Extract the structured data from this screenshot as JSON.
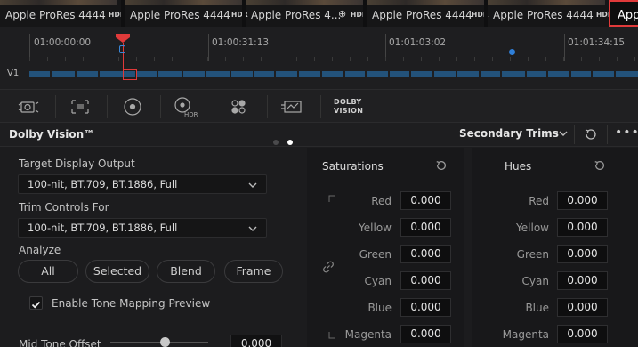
{
  "clips": [
    {
      "name": "Apple ProRes 4444",
      "badge": "HDR"
    },
    {
      "name": "Apple ProRes 4444",
      "badge": "HDR"
    },
    {
      "name": "Apple ProRes 4...",
      "badge": "HDR"
    },
    {
      "name": "Apple ProRes 4444",
      "badge": "HDR"
    },
    {
      "name": "Apple ProRes 4444",
      "badge": "HDR"
    },
    {
      "name": "Apple",
      "badge": ""
    }
  ],
  "timeline": {
    "timecodes": [
      "01:00:00:00",
      "01:00:31:13",
      "01:01:03:02",
      "01:01:34:15"
    ],
    "track_label": "V1"
  },
  "toolbar": {
    "dolby_line1": "DOLBY",
    "dolby_line2": "VISION",
    "icons": [
      "camera-raw-icon",
      "color-match-icon",
      "primaries-icon",
      "hdr-icon",
      "rgb-mixer-icon",
      "motion-effects-icon"
    ]
  },
  "panel": {
    "title": "Dolby Vision™",
    "trims_select": "Secondary Trims"
  },
  "left": {
    "target_label": "Target Display Output",
    "target_value": "100-nit, BT.709, BT.1886, Full",
    "trim_label": "Trim Controls For",
    "trim_value": "100-nit, BT.709, BT.1886, Full",
    "analyze_label": "Analyze",
    "analyze_buttons": [
      "All",
      "Selected",
      "Blend",
      "Frame"
    ],
    "tone_mapping_label": "Enable Tone Mapping Preview",
    "tone_mapping_checked": true,
    "mid_tone_label": "Mid Tone Offset",
    "mid_tone_value": "0.000"
  },
  "saturations": {
    "title": "Saturations",
    "rows": [
      {
        "label": "Red",
        "value": "0.000"
      },
      {
        "label": "Yellow",
        "value": "0.000"
      },
      {
        "label": "Green",
        "value": "0.000"
      },
      {
        "label": "Cyan",
        "value": "0.000"
      },
      {
        "label": "Blue",
        "value": "0.000"
      },
      {
        "label": "Magenta",
        "value": "0.000"
      }
    ]
  },
  "hues": {
    "title": "Hues",
    "rows": [
      {
        "label": "Red",
        "value": "0.000"
      },
      {
        "label": "Yellow",
        "value": "0.000"
      },
      {
        "label": "Green",
        "value": "0.000"
      },
      {
        "label": "Cyan",
        "value": "0.000"
      },
      {
        "label": "Blue",
        "value": "0.000"
      },
      {
        "label": "Magenta",
        "value": "0.000"
      }
    ]
  },
  "colors": {
    "playhead": "#e03a3a",
    "track": "#23527a",
    "marker": "#2f7fd8",
    "dot_active": "#ffffff",
    "dot_inactive": "#4a4a4c"
  }
}
